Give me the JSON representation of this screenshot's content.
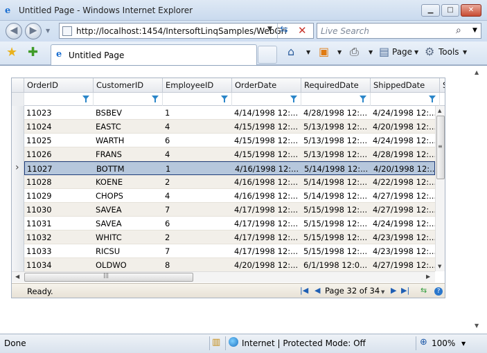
{
  "window": {
    "title": "Untitled Page - Windows Internet Explorer"
  },
  "address": {
    "url": "http://localhost:1454/IntersoftLinqSamples/WebGri",
    "search_placeholder": "Live Search"
  },
  "tab": {
    "label": "Untitled Page"
  },
  "commands": {
    "page": "Page",
    "tools": "Tools"
  },
  "grid": {
    "columns": [
      "OrderID",
      "CustomerID",
      "EmployeeID",
      "OrderDate",
      "RequiredDate",
      "ShippedDate",
      "S"
    ],
    "rows": [
      [
        "11023",
        "BSBEV",
        "1",
        "4/14/1998 12:...",
        "4/28/1998 12:...",
        "4/24/1998 12:..."
      ],
      [
        "11024",
        "EASTC",
        "4",
        "4/15/1998 12:...",
        "5/13/1998 12:...",
        "4/20/1998 12:..."
      ],
      [
        "11025",
        "WARTH",
        "6",
        "4/15/1998 12:...",
        "5/13/1998 12:...",
        "4/24/1998 12:..."
      ],
      [
        "11026",
        "FRANS",
        "4",
        "4/15/1998 12:...",
        "5/13/1998 12:...",
        "4/28/1998 12:..."
      ],
      [
        "11027",
        "BOTTM",
        "1",
        "4/16/1998 12:...",
        "5/14/1998 12:...",
        "4/20/1998 12:..."
      ],
      [
        "11028",
        "KOENE",
        "2",
        "4/16/1998 12:...",
        "5/14/1998 12:...",
        "4/22/1998 12:..."
      ],
      [
        "11029",
        "CHOPS",
        "4",
        "4/16/1998 12:...",
        "5/14/1998 12:...",
        "4/27/1998 12:..."
      ],
      [
        "11030",
        "SAVEA",
        "7",
        "4/17/1998 12:...",
        "5/15/1998 12:...",
        "4/27/1998 12:..."
      ],
      [
        "11031",
        "SAVEA",
        "6",
        "4/17/1998 12:...",
        "5/15/1998 12:...",
        "4/24/1998 12:..."
      ],
      [
        "11032",
        "WHITC",
        "2",
        "4/17/1998 12:...",
        "5/15/1998 12:...",
        "4/23/1998 12:..."
      ],
      [
        "11033",
        "RICSU",
        "7",
        "4/17/1998 12:...",
        "5/15/1998 12:...",
        "4/23/1998 12:..."
      ],
      [
        "11034",
        "OLDWO",
        "8",
        "4/20/1998 12:...",
        "6/1/1998 12:0...",
        "4/27/1998 12:..."
      ]
    ],
    "selected_row": 4,
    "status": "Ready.",
    "pager": "Page 32 of 34"
  },
  "statusbar": {
    "left": "Done",
    "zone": "Internet | Protected Mode: Off",
    "zoom": "100%"
  },
  "colors": {
    "selected_row": "#b6c7dc",
    "alt_row": "#f2efe9",
    "funnel": "#2b86c9"
  }
}
